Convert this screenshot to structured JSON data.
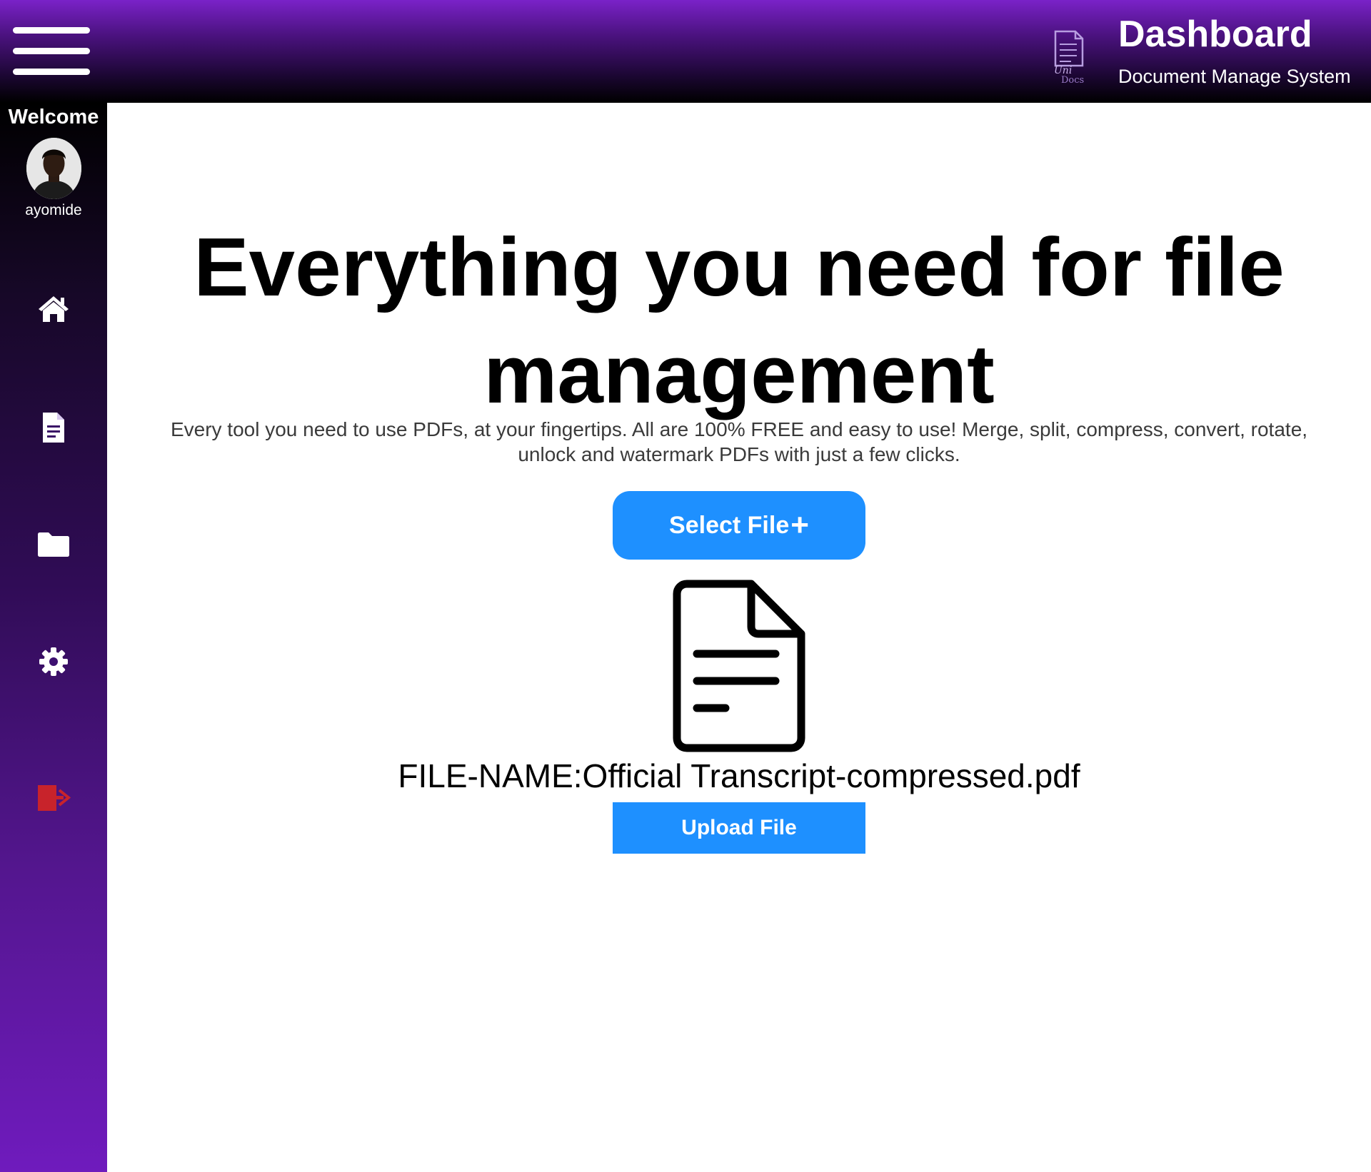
{
  "header": {
    "title": "Dashboard",
    "subtitle": "Document Manage System",
    "logo_text_top": "Uni",
    "logo_text_bottom": "Docs",
    "menu_icon": "hamburger-menu-icon"
  },
  "sidebar": {
    "welcome": "Welcome",
    "username": "ayomide",
    "items": [
      {
        "icon": "home-icon"
      },
      {
        "icon": "document-icon"
      },
      {
        "icon": "folder-icon"
      },
      {
        "icon": "gear-icon"
      },
      {
        "icon": "logout-icon",
        "color": "#c8232b"
      }
    ]
  },
  "main": {
    "headline": "Everything you need for file management",
    "tagline": "Every tool you need to use PDFs, at your fingertips. All are 100% FREE and easy to use! Merge, split, compress, convert, rotate, unlock and watermark PDFs with just a few clicks.",
    "select_button": "Select File",
    "select_button_icon": "plus-icon",
    "file_icon": "file-document-icon",
    "file_name": "FILE-NAME:Official Transcript-compressed.pdf",
    "upload_button": "Upload File"
  },
  "colors": {
    "accent": "#1e90ff",
    "header_top": "#7a22c8",
    "sidebar_bottom": "#6f1bbd",
    "logout": "#c8232b"
  }
}
